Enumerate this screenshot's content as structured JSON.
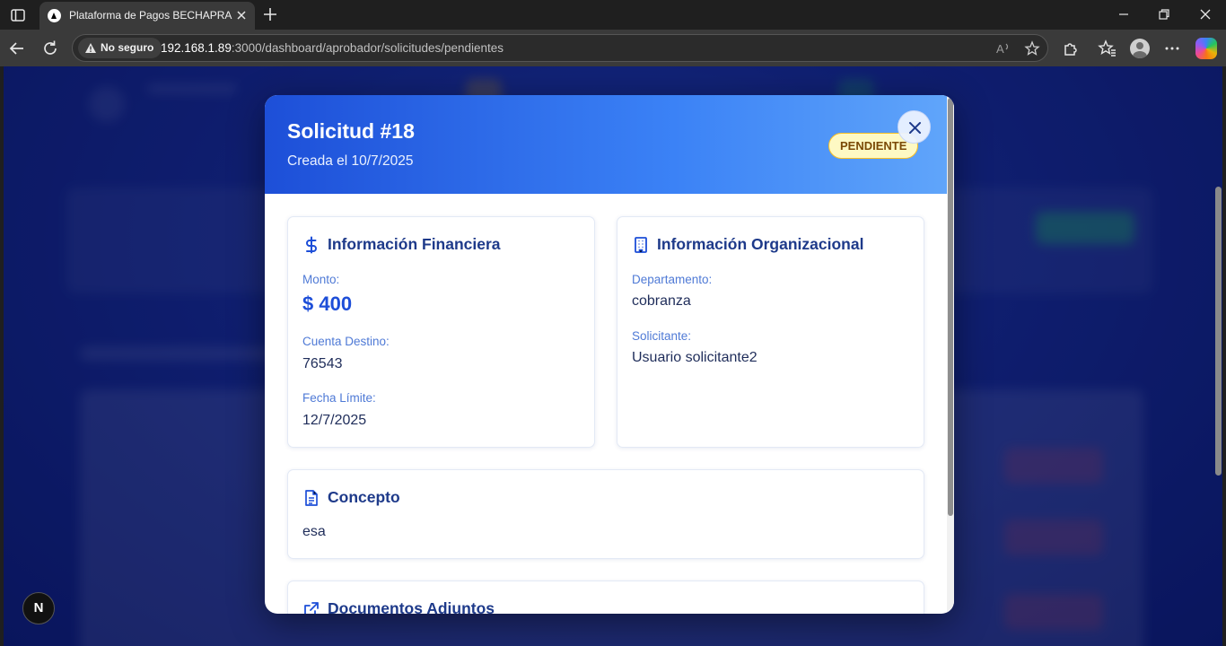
{
  "browser": {
    "tab_title": "Plataforma de Pagos BECHAPRA",
    "security_label": "No seguro",
    "url_host": "192.168.1.89",
    "url_rest": ":3000/dashboard/aprobador/solicitudes/pendientes"
  },
  "modal": {
    "title": "Solicitud #18",
    "subtitle": "Creada el 10/7/2025",
    "status": "PENDIENTE",
    "financial": {
      "title": "Información Financiera",
      "amount_label": "Monto:",
      "amount_value": "$ 400",
      "account_label": "Cuenta Destino:",
      "account_value": "76543",
      "deadline_label": "Fecha Límite:",
      "deadline_value": "12/7/2025"
    },
    "organizational": {
      "title": "Información Organizacional",
      "department_label": "Departamento:",
      "department_value": "cobranza",
      "requester_label": "Solicitante:",
      "requester_value": "Usuario solicitante2"
    },
    "concept": {
      "title": "Concepto",
      "value": "esa"
    },
    "documents": {
      "title": "Documentos Adjuntos"
    }
  },
  "colors": {
    "header_start": "#1d4fd8",
    "header_end": "#60a5fa",
    "title_text": "#1e3a8a",
    "amount": "#1d4ed8",
    "status_bg": "#fef9c3",
    "status_border": "#fbbf24"
  },
  "icons": {
    "tab_favicon": "nextjs-icon",
    "close": "close-icon",
    "financial": "dollar-sign-icon",
    "organizational": "building-icon",
    "concept": "file-text-icon",
    "documents": "external-link-icon",
    "dev_badge": "nextjs-dev-icon"
  },
  "dev_badge_letter": "N"
}
